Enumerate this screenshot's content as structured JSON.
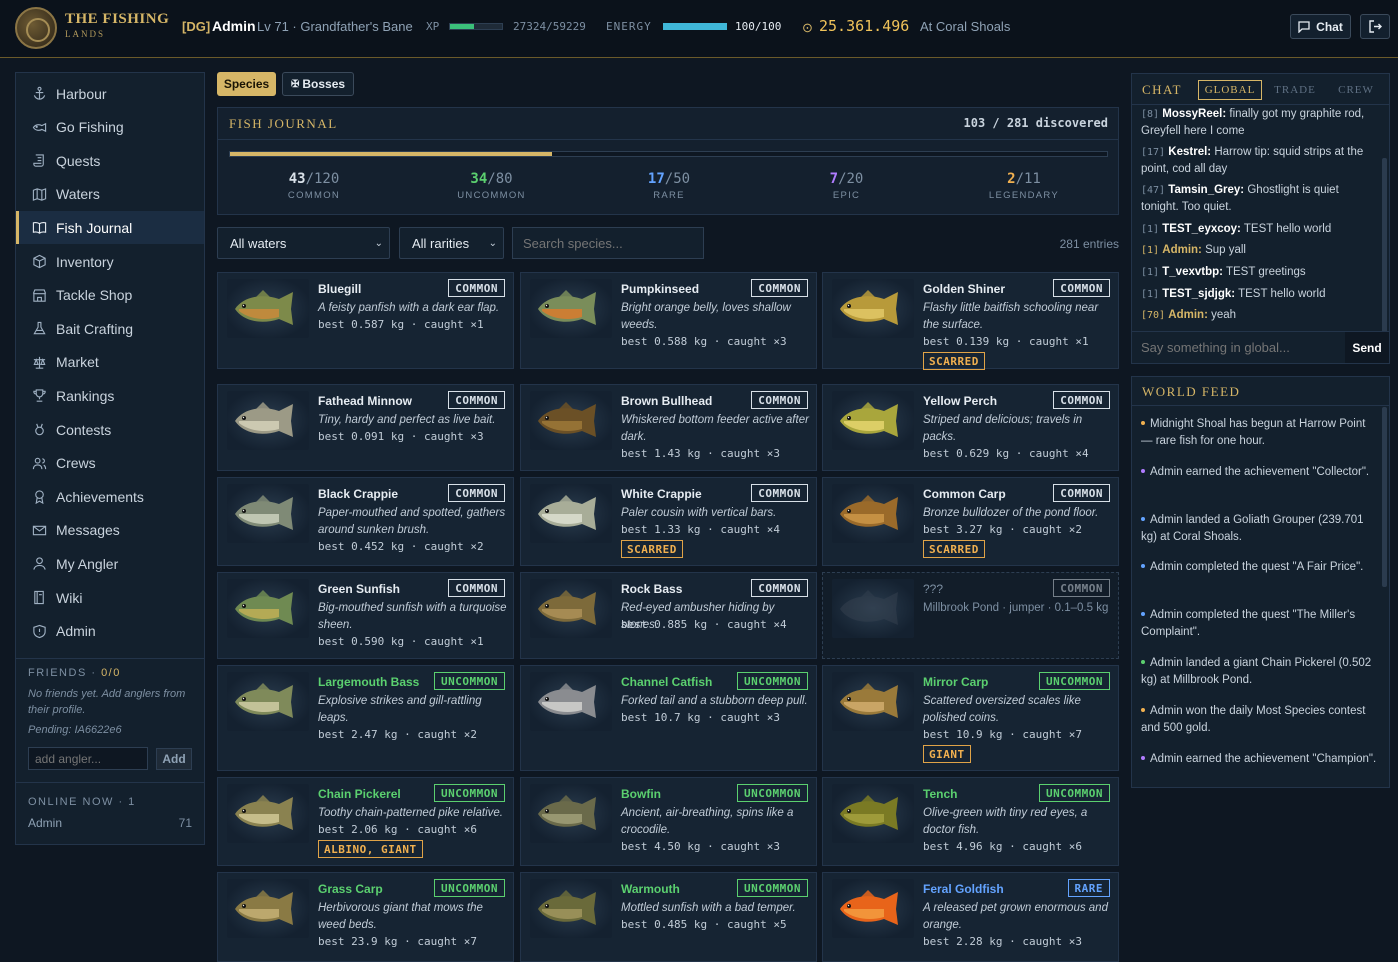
{
  "app": {
    "title_line1": "THE FISHING",
    "title_line2": "LANDS"
  },
  "topbar": {
    "tag": "[DG]",
    "username": "Admin",
    "level_title": "Lv 71 · Grandfather's Bane",
    "xp_label": "XP",
    "xp_value": "27324/59229",
    "xp_fraction": 0.46,
    "energy_label": "ENERGY",
    "energy_value": "100/100",
    "energy_fraction": 1.0,
    "gold": "25.361.496",
    "location": "At Coral Shoals",
    "chat_button": "Chat"
  },
  "sidebar": {
    "items": [
      {
        "label": "Harbour",
        "icon": "anchor-icon"
      },
      {
        "label": "Go Fishing",
        "icon": "fish-icon"
      },
      {
        "label": "Quests",
        "icon": "scroll-icon"
      },
      {
        "label": "Waters",
        "icon": "map-icon"
      },
      {
        "label": "Fish Journal",
        "icon": "book-icon",
        "active": true
      },
      {
        "label": "Inventory",
        "icon": "box-icon"
      },
      {
        "label": "Tackle Shop",
        "icon": "store-icon"
      },
      {
        "label": "Bait Crafting",
        "icon": "flask-icon"
      },
      {
        "label": "Market",
        "icon": "scale-icon"
      },
      {
        "label": "Rankings",
        "icon": "trophy-icon"
      },
      {
        "label": "Contests",
        "icon": "medal-icon"
      },
      {
        "label": "Crews",
        "icon": "users-icon"
      },
      {
        "label": "Achievements",
        "icon": "award-icon"
      },
      {
        "label": "Messages",
        "icon": "mail-icon"
      },
      {
        "label": "My Angler",
        "icon": "user-icon"
      },
      {
        "label": "Wiki",
        "icon": "book-open-icon"
      },
      {
        "label": "Admin",
        "icon": "shield-icon"
      }
    ],
    "friends": {
      "label": "FRIENDS · ",
      "count": "0/0",
      "empty_text": "No friends yet. Add anglers from their profile.",
      "pending": "Pending: IA6622e6",
      "input_placeholder": "add angler...",
      "add_button": "Add"
    },
    "online": {
      "label": "ONLINE NOW · 1",
      "user": "Admin",
      "level": "71"
    }
  },
  "main": {
    "tabs": {
      "species": "Species",
      "bosses": "Bosses"
    },
    "journal": {
      "title": "FISH JOURNAL",
      "discovered": "103 / 281 discovered",
      "progress_fraction": 0.367,
      "rarities": [
        {
          "count": "43",
          "total": "/120",
          "label": "COMMON",
          "color": "#d8e0e8"
        },
        {
          "count": "34",
          "total": "/80",
          "label": "UNCOMMON",
          "color": "#5bd06f"
        },
        {
          "count": "17",
          "total": "/50",
          "label": "RARE",
          "color": "#63a3ff"
        },
        {
          "count": "7",
          "total": "/20",
          "label": "EPIC",
          "color": "#b07cff"
        },
        {
          "count": "2",
          "total": "/11",
          "label": "LEGENDARY",
          "color": "#f0b050"
        }
      ]
    },
    "filters": {
      "waters": "All waters",
      "rarities": "All rarities",
      "search_placeholder": "Search species...",
      "entries": "281 entries"
    },
    "fish": [
      {
        "name": "Bluegill",
        "rarity": "COMMON",
        "desc": "A feisty panfish with a dark ear flap.",
        "stat": "best 0.587 kg · caught ×1",
        "tag": "",
        "body": "#7d8a4a",
        "belly": "#d08a3a"
      },
      {
        "name": "Pumpkinseed",
        "rarity": "COMMON",
        "desc": "Bright orange belly, loves shallow weeds.",
        "stat": "best 0.588 kg · caught ×3",
        "tag": "",
        "body": "#7a8d5a",
        "belly": "#e07a2a"
      },
      {
        "name": "Golden Shiner",
        "rarity": "COMMON",
        "desc": "Flashy little baitfish schooling near the surface.",
        "stat": "best 0.139 kg · caught ×1",
        "tag": "SCARRED",
        "body": "#b89a3a",
        "belly": "#e5cb6a"
      },
      {
        "name": "Fathead Minnow",
        "rarity": "COMMON",
        "desc": "Tiny, hardy and perfect as live bait.",
        "stat": "best 0.091 kg · caught ×3",
        "tag": "",
        "body": "#9c9a86",
        "belly": "#d8d4bc"
      },
      {
        "name": "Brown Bullhead",
        "rarity": "COMMON",
        "desc": "Whiskered bottom feeder active after dark.",
        "stat": "best 1.43 kg · caught ×3",
        "tag": "",
        "body": "#6b5026",
        "belly": "#a07a3a"
      },
      {
        "name": "Yellow Perch",
        "rarity": "COMMON",
        "desc": "Striped and delicious; travels in packs.",
        "stat": "best 0.629 kg · caught ×4",
        "tag": "",
        "body": "#a9a63c",
        "belly": "#e8d870"
      },
      {
        "name": "Black Crappie",
        "rarity": "COMMON",
        "desc": "Paper-mouthed and spotted, gathers around sunken brush.",
        "stat": "best 0.452 kg · caught ×2",
        "tag": "",
        "body": "#7f8a76",
        "belly": "#cfd4c2"
      },
      {
        "name": "White Crappie",
        "rarity": "COMMON",
        "desc": "Paler cousin with vertical bars.",
        "stat": "best 1.33 kg · caught ×4",
        "tag": "SCARRED",
        "body": "#a8ad98",
        "belly": "#e0e2d4"
      },
      {
        "name": "Common Carp",
        "rarity": "COMMON",
        "desc": "Bronze bulldozer of the pond floor.",
        "stat": "best 3.27 kg · caught ×2",
        "tag": "SCARRED",
        "body": "#9a6a2a",
        "belly": "#d09a4a"
      },
      {
        "name": "Green Sunfish",
        "rarity": "COMMON",
        "desc": "Big-mouthed sunfish with a turquoise sheen.",
        "stat": "best 0.590 kg · caught ×1",
        "tag": "",
        "body": "#6f8a52",
        "belly": "#c6b256"
      },
      {
        "name": "Rock Bass",
        "rarity": "COMMON",
        "desc": "Red-eyed ambusher hiding by stones.",
        "stat": "best 0.885 kg · caught ×4",
        "tag": "",
        "body": "#7d6a3a",
        "belly": "#b0945a"
      },
      {
        "name": "???",
        "rarity": "COMMON",
        "desc": "Millbrook Pond · jumper · 0.1–0.5 kg",
        "stat": "",
        "tag": "",
        "unknown": true,
        "body": "#3a4553",
        "belly": "#3a4553"
      },
      {
        "name": "Largemouth Bass",
        "rarity": "UNCOMMON",
        "desc": "Explosive strikes and gill-rattling leaps.",
        "stat": "best 2.47 kg · caught ×2",
        "tag": "",
        "body": "#7f8a5a",
        "belly": "#d4d0a8"
      },
      {
        "name": "Channel Catfish",
        "rarity": "UNCOMMON",
        "desc": "Forked tail and a stubborn deep pull.",
        "stat": "best 10.7 kg · caught ×3",
        "tag": "",
        "body": "#8a8c90",
        "belly": "#d6d6d2"
      },
      {
        "name": "Mirror Carp",
        "rarity": "UNCOMMON",
        "desc": "Scattered oversized scales like polished coins.",
        "stat": "best 10.9 kg · caught ×7",
        "tag": "GIANT",
        "body": "#9a7a3a",
        "belly": "#d4b070"
      },
      {
        "name": "Chain Pickerel",
        "rarity": "UNCOMMON",
        "desc": "Toothy chain-patterned pike relative.",
        "stat": "best 2.06 kg · caught ×6",
        "tag": "ALBINO, GIANT",
        "body": "#8a8250",
        "belly": "#d4cc98"
      },
      {
        "name": "Bowfin",
        "rarity": "UNCOMMON",
        "desc": "Ancient, air-breathing, spins like a crocodile.",
        "stat": "best 4.50 kg · caught ×3",
        "tag": "",
        "body": "#6a6a4a",
        "belly": "#a4a27a"
      },
      {
        "name": "Tench",
        "rarity": "UNCOMMON",
        "desc": "Olive-green with tiny red eyes, a doctor fish.",
        "stat": "best 4.96 kg · caught ×6",
        "tag": "",
        "body": "#7a7a24",
        "belly": "#a8a440"
      },
      {
        "name": "Grass Carp",
        "rarity": "UNCOMMON",
        "desc": "Herbivorous giant that mows the weed beds.",
        "stat": "best 23.9 kg · caught ×7",
        "tag": "",
        "body": "#8a7a44",
        "belly": "#c8b478"
      },
      {
        "name": "Warmouth",
        "rarity": "UNCOMMON",
        "desc": "Mottled sunfish with a bad temper.",
        "stat": "best 0.485 kg · caught ×5",
        "tag": "",
        "body": "#6a6a3a",
        "belly": "#a49860"
      },
      {
        "name": "Feral Goldfish",
        "rarity": "RARE",
        "desc": "A released pet grown enormous and orange.",
        "stat": "best 2.28 kg · caught ×3",
        "tag": "",
        "body": "#e8641a",
        "belly": "#f4a042"
      }
    ]
  },
  "chat": {
    "title": "CHAT",
    "tabs": [
      "GLOBAL",
      "TRADE",
      "CREW"
    ],
    "messages": [
      {
        "ts": "[8]",
        "user": "MossyReel:",
        "text": " finally got my graphite rod, Greyfell here I come",
        "admin": false
      },
      {
        "ts": "[17]",
        "user": "Kestrel:",
        "text": " Harrow tip: squid strips at the point, cod all day",
        "admin": false
      },
      {
        "ts": "[47]",
        "user": "Tamsin_Grey:",
        "text": " Ghostlight is quiet tonight. Too quiet.",
        "admin": false
      },
      {
        "ts": "[1]",
        "user": "TEST_eyxcoy:",
        "text": " TEST hello world",
        "admin": false
      },
      {
        "ts": "[1]",
        "user": "Admin:",
        "text": " Sup yall",
        "admin": true
      },
      {
        "ts": "[1]",
        "user": "T_vexvtbp:",
        "text": " TEST greetings",
        "admin": false
      },
      {
        "ts": "[1]",
        "user": "TEST_sjdjgk:",
        "text": " TEST hello world",
        "admin": false
      },
      {
        "ts": "[70]",
        "user": "Admin:",
        "text": " yeah",
        "admin": true
      }
    ],
    "input_placeholder": "Say something in global...",
    "send": "Send"
  },
  "feed": {
    "title": "WORLD FEED",
    "items": [
      {
        "text": "Midnight Shoal has begun at Harrow Point — rare fish for one hour.",
        "color": "#f0b050"
      },
      {
        "text": "Admin earned the achievement \"Collector\".",
        "color": "#b07cff"
      },
      {
        "text": "Admin landed a Goliath Grouper (239.701 kg) at Coral Shoals.",
        "color": "#63a3ff"
      },
      {
        "text": "Admin completed the quest \"A Fair Price\".",
        "color": "#63a3ff"
      },
      {
        "text": "Admin completed the quest \"The Miller's Complaint\".",
        "color": "#63a3ff"
      },
      {
        "text": "Admin landed a giant Chain Pickerel (0.502 kg) at Millbrook Pond.",
        "color": "#5bd06f"
      },
      {
        "text": "Admin won the daily Most Species contest and 500 gold.",
        "color": "#f0b050"
      },
      {
        "text": "Admin earned the achievement \"Champion\".",
        "color": "#b07cff"
      }
    ]
  }
}
